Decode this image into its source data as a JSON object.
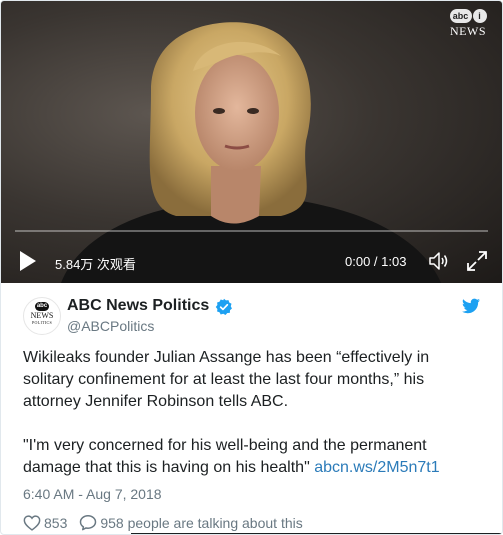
{
  "video": {
    "watermark": {
      "logo_text": "abc",
      "badge_text": "i",
      "brand_text": "NEWS"
    },
    "progress": 0,
    "views_text": "5.84万 次观看",
    "timecode_text": "0:00 / 1:03",
    "icons": {
      "play": "play-icon",
      "volume": "volume-icon",
      "fullscreen": "fullscreen-icon"
    }
  },
  "tweet": {
    "avatar": {
      "logo_text": "abc",
      "news_text": "NEWS",
      "politics_text": "POLITICS"
    },
    "display_name": "ABC News Politics",
    "handle": "@ABCPolitics",
    "verified_icon": "verified-badge-icon",
    "bird_icon": "twitter-bird-icon",
    "paragraph_1": "Wikileaks founder Julian Assange has been “effectively in solitary confinement for at least the last four months,” his attorney Jennifer Robinson tells ABC.",
    "paragraph_2_text": "\"I'm very concerned for his well-being and the permanent damage that this is having on his health\" ",
    "paragraph_2_link": "abcn.ws/2M5n7t1",
    "timestamp": "6:40 AM - Aug 7, 2018",
    "likes_count": "853",
    "replies_text": "958 people are talking about this"
  },
  "colors": {
    "link": "#2b7bb9",
    "verified": "#1da1f2",
    "muted": "#697882",
    "text": "#1c2022"
  }
}
